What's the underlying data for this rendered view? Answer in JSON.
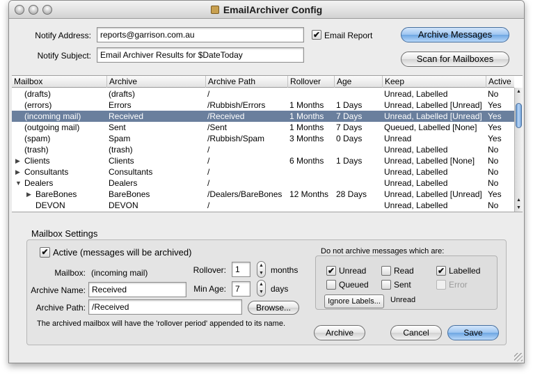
{
  "window": {
    "title": "EmailArchiver Config"
  },
  "notify": {
    "address_label": "Notify Address:",
    "address_value": "reports@garrison.com.au",
    "subject_label": "Notify Subject:",
    "subject_value": "Email Archiver Results for $DateToday",
    "email_report_label": "Email Report",
    "email_report_checked": true
  },
  "buttons": {
    "archive_messages": "Archive Messages",
    "scan_mailboxes": "Scan for Mailboxes",
    "archive": "Archive",
    "cancel": "Cancel",
    "save": "Save",
    "browse": "Browse...",
    "ignore_labels": "Ignore Labels..."
  },
  "table": {
    "columns": [
      "Mailbox",
      "Archive",
      "Archive Path",
      "Rollover",
      "Age",
      "Keep",
      "Active"
    ],
    "rows": [
      {
        "mailbox": "(drafts)",
        "archive": "(drafts)",
        "path": "/",
        "rollover": "",
        "age": "",
        "keep": "Unread, Labelled",
        "active": "No",
        "level": 0,
        "disclosure": "",
        "selected": false
      },
      {
        "mailbox": "(errors)",
        "archive": "Errors",
        "path": "/Rubbish/Errors",
        "rollover": "1 Months",
        "age": "1 Days",
        "keep": "Unread, Labelled [Unread]",
        "active": "Yes",
        "level": 0,
        "disclosure": "",
        "selected": false
      },
      {
        "mailbox": "(incoming mail)",
        "archive": "Received",
        "path": "/Received",
        "rollover": "1 Months",
        "age": "7 Days",
        "keep": "Unread, Labelled [Unread]",
        "active": "Yes",
        "level": 0,
        "disclosure": "",
        "selected": true
      },
      {
        "mailbox": "(outgoing mail)",
        "archive": "Sent",
        "path": "/Sent",
        "rollover": "1 Months",
        "age": "7 Days",
        "keep": "Queued, Labelled [None]",
        "active": "Yes",
        "level": 0,
        "disclosure": "",
        "selected": false
      },
      {
        "mailbox": "(spam)",
        "archive": "Spam",
        "path": "/Rubbish/Spam",
        "rollover": "3 Months",
        "age": "0 Days",
        "keep": "Unread",
        "active": "Yes",
        "level": 0,
        "disclosure": "",
        "selected": false
      },
      {
        "mailbox": "(trash)",
        "archive": "(trash)",
        "path": "/",
        "rollover": "",
        "age": "",
        "keep": "Unread, Labelled",
        "active": "No",
        "level": 0,
        "disclosure": "",
        "selected": false
      },
      {
        "mailbox": "Clients",
        "archive": "Clients",
        "path": "/",
        "rollover": "6 Months",
        "age": "1 Days",
        "keep": "Unread, Labelled [None]",
        "active": "No",
        "level": 0,
        "disclosure": "closed",
        "selected": false
      },
      {
        "mailbox": "Consultants",
        "archive": "Consultants",
        "path": "/",
        "rollover": "",
        "age": "",
        "keep": "Unread, Labelled",
        "active": "No",
        "level": 0,
        "disclosure": "closed",
        "selected": false
      },
      {
        "mailbox": "Dealers",
        "archive": "Dealers",
        "path": "/",
        "rollover": "",
        "age": "",
        "keep": "Unread, Labelled",
        "active": "No",
        "level": 0,
        "disclosure": "open",
        "selected": false
      },
      {
        "mailbox": "BareBones",
        "archive": "BareBones",
        "path": "/Dealers/BareBones",
        "rollover": "12 Months",
        "age": "28 Days",
        "keep": "Unread, Labelled [Unread]",
        "active": "Yes",
        "level": 1,
        "disclosure": "closed",
        "selected": false
      },
      {
        "mailbox": "DEVON",
        "archive": "DEVON",
        "path": "/",
        "rollover": "",
        "age": "",
        "keep": "Unread, Labelled",
        "active": "No",
        "level": 1,
        "disclosure": "",
        "selected": false
      }
    ]
  },
  "settings": {
    "title": "Mailbox Settings",
    "active_label": "Active (messages will be archived)",
    "active_checked": true,
    "mailbox_label": "Mailbox:",
    "mailbox_value": "(incoming mail)",
    "archive_name_label": "Archive Name:",
    "archive_name_value": "Received",
    "archive_path_label": "Archive Path:",
    "archive_path_value": "/Received",
    "rollover_label": "Rollover:",
    "rollover_value": "1",
    "rollover_unit": "months",
    "min_age_label": "Min Age:",
    "min_age_value": "7",
    "min_age_unit": "days",
    "note": "The archived mailbox will have the 'rollover period' appended to its name.",
    "do_not_archive_label": "Do not archive messages which are:",
    "options": [
      {
        "label": "Unread",
        "checked": true,
        "disabled": false
      },
      {
        "label": "Read",
        "checked": false,
        "disabled": false
      },
      {
        "label": "Labelled",
        "checked": true,
        "disabled": false
      },
      {
        "label": "Queued",
        "checked": false,
        "disabled": false
      },
      {
        "label": "Sent",
        "checked": false,
        "disabled": false
      },
      {
        "label": "Error",
        "checked": false,
        "disabled": true
      }
    ],
    "ignore_labels_value": "Unread"
  },
  "icons": {
    "check": "✔",
    "disclosure_closed": "▶",
    "disclosure_open": "▼",
    "arrow_up": "▲",
    "arrow_down": "▼"
  },
  "colors": {
    "selection": "#6a7f9d",
    "accent_button": "#9cc4f0"
  }
}
